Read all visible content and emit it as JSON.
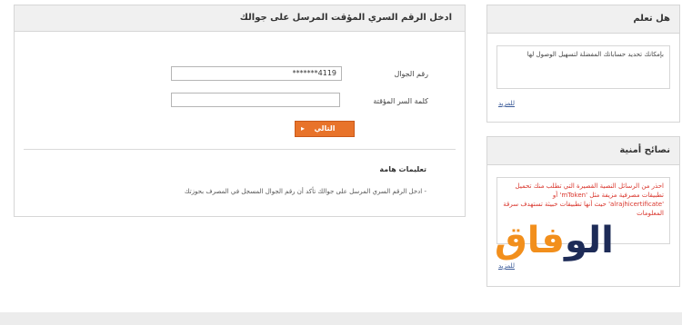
{
  "form": {
    "header": "ادخل الرقم السري المؤقت المرسل على جوالك",
    "mobile_label": "رقم الجوال",
    "mobile_value": "*******4119",
    "otp_label": "كلمة السر المؤقتة",
    "otp_value": "",
    "next_button": "التالي",
    "next_arrow": "▸",
    "notes_title": "تعليمات هامة",
    "notes_item": "- ادخل الرقم السري المرسل على جوالك تأكد أن رقم الجوال المسجل في المصرف بحوزتك"
  },
  "sidebar": {
    "did_you_know": {
      "title": "هل تعلم",
      "text": "بإمكانك تحديد حساباتك المفضلة لتسهيل الوصول لها",
      "more": "للمزيد"
    },
    "security_tips": {
      "title": "نصائح أمنية",
      "text": "احذر من الرسائل النصية القصيرة التي تطلب منك تحميل تطبيقات مصرفية مزيفة مثل 'mToken' أو 'alrajhicertificate' حيث أنها تطبيقات خبيثة تستهدف سرقة المعلومات",
      "more": "للمزيد"
    }
  },
  "logo": {
    "part1": "الو",
    "part2": "فاق"
  },
  "colors": {
    "accent": "#e8732a",
    "warning_text": "#d9342b",
    "link": "#3a5a98"
  }
}
